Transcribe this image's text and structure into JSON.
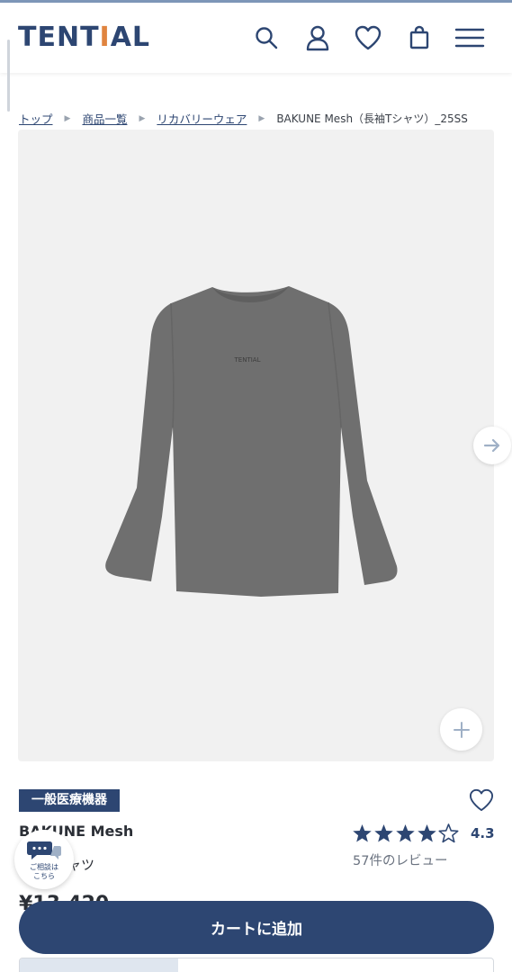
{
  "header": {
    "logo_text_a": "TENT",
    "logo_text_b": "I",
    "logo_text_c": "AL",
    "icons": [
      "search-icon",
      "account-icon",
      "heart-icon",
      "bag-icon",
      "menu-icon"
    ]
  },
  "breadcrumb": {
    "items": [
      "トップ",
      "商品一覧",
      "リカバリーウェア"
    ],
    "current": "BAKUNE Mesh（長袖Tシャツ）_25SS"
  },
  "product": {
    "image_alt_icon": "tshirt-image",
    "shirt_print": "TENTIAL",
    "badge": "一般医療機器",
    "name": "BAKUNE Mesh",
    "subtitle": "シャツ",
    "price": "¥13,420",
    "rating": {
      "value": "4.3",
      "stars_filled": 4.3,
      "stars_total": 5,
      "review_count": "57件のレビュー"
    }
  },
  "chat": {
    "label": "ご相談は\nこちら"
  },
  "actions": {
    "cart_label": "カートに追加"
  },
  "colors": {
    "brand": "#2d4672",
    "accent": "#e0843f",
    "image_bg": "#f1f1f1",
    "shirt": "#6f6f6f"
  }
}
